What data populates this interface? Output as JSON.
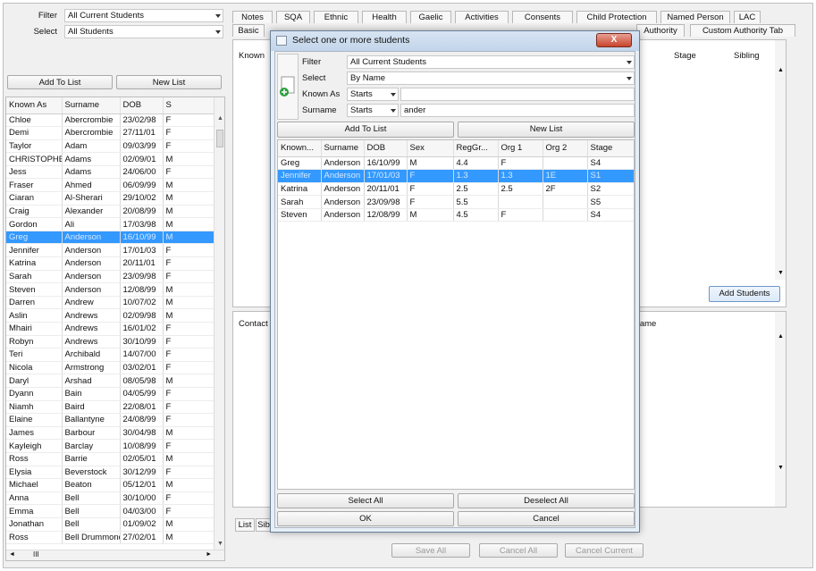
{
  "left": {
    "filter_label": "Filter",
    "filter_value": "All Current Students",
    "select_label": "Select",
    "select_value": "All Students",
    "add_to_list": "Add To List",
    "new_list": "New List",
    "columns": [
      "Known As",
      "Surname",
      "DOB",
      "S"
    ],
    "rows": [
      [
        "Chloe",
        "Abercrombie",
        "23/02/98",
        "F"
      ],
      [
        "Demi",
        "Abercrombie",
        "27/11/01",
        "F"
      ],
      [
        "Taylor",
        "Adam",
        "09/03/99",
        "F"
      ],
      [
        "CHRISTOPHER",
        "Adams",
        "02/09/01",
        "M"
      ],
      [
        "Jess",
        "Adams",
        "24/06/00",
        "F"
      ],
      [
        "Fraser",
        "Ahmed",
        "06/09/99",
        "M"
      ],
      [
        "Ciaran",
        "Al-Sherari",
        "29/10/02",
        "M"
      ],
      [
        "Craig",
        "Alexander",
        "20/08/99",
        "M"
      ],
      [
        "Gordon",
        "Ali",
        "17/03/98",
        "M"
      ],
      [
        "Greg",
        "Anderson",
        "16/10/99",
        "M"
      ],
      [
        "Jennifer",
        "Anderson",
        "17/01/03",
        "F"
      ],
      [
        "Katrina",
        "Anderson",
        "20/11/01",
        "F"
      ],
      [
        "Sarah",
        "Anderson",
        "23/09/98",
        "F"
      ],
      [
        "Steven",
        "Anderson",
        "12/08/99",
        "M"
      ],
      [
        "Darren",
        "Andrew",
        "10/07/02",
        "M"
      ],
      [
        "Aslin",
        "Andrews",
        "02/09/98",
        "M"
      ],
      [
        "Mhairi",
        "Andrews",
        "16/01/02",
        "F"
      ],
      [
        "Robyn",
        "Andrews",
        "30/10/99",
        "F"
      ],
      [
        "Teri",
        "Archibald",
        "14/07/00",
        "F"
      ],
      [
        "Nicola",
        "Armstrong",
        "03/02/01",
        "F"
      ],
      [
        "Daryl",
        "Arshad",
        "08/05/98",
        "M"
      ],
      [
        "Dyann",
        "Bain",
        "04/05/99",
        "F"
      ],
      [
        "Niamh",
        "Baird",
        "22/08/01",
        "F"
      ],
      [
        "Elaine",
        "Ballantyne",
        "24/08/99",
        "F"
      ],
      [
        "James",
        "Barbour",
        "30/04/98",
        "M"
      ],
      [
        "Kayleigh",
        "Barclay",
        "10/08/99",
        "F"
      ],
      [
        "Ross",
        "Barrie",
        "02/05/01",
        "M"
      ],
      [
        "Elysia",
        "Beverstock",
        "30/12/99",
        "F"
      ],
      [
        "Michael",
        "Beaton",
        "05/12/01",
        "M"
      ],
      [
        "Anna",
        "Bell",
        "30/10/00",
        "F"
      ],
      [
        "Emma",
        "Bell",
        "04/03/00",
        "F"
      ],
      [
        "Jonathan",
        "Bell",
        "01/09/02",
        "M"
      ],
      [
        "Ross",
        "Bell Drummond",
        "27/02/01",
        "M"
      ]
    ],
    "selected_row": 9,
    "hscroll_text": "III"
  },
  "tabs_row1": [
    "Notes",
    "SQA",
    "Ethnic",
    "Health",
    "Gaelic",
    "Activities",
    "Consents",
    "Child Protection",
    "Named Person",
    "LAC"
  ],
  "tabs_row2": [
    "Basic",
    "Authority",
    "Custom Authority Tab"
  ],
  "right": {
    "known_as_header": "Known",
    "stage_header": "Stage",
    "sibling_header": "Sibling",
    "add_students": "Add Students",
    "contact_header": "Contact",
    "name_header": "Name",
    "list_tab": "List",
    "second_tab": "Sib",
    "save_all": "Save All",
    "cancel_all": "Cancel All",
    "cancel_current": "Cancel Current"
  },
  "dialog": {
    "title": "Select one or more students",
    "close": "X",
    "filter_label": "Filter",
    "filter_value": "All Current Students",
    "select_label": "Select",
    "select_value": "By Name",
    "known_as_label": "Known As",
    "known_as_mode": "Starts",
    "known_as_value": "",
    "surname_label": "Surname",
    "surname_mode": "Starts",
    "surname_value": "ander",
    "add_to_list": "Add To List",
    "new_list": "New List",
    "columns": [
      "Known...",
      "Surname",
      "DOB",
      "Sex",
      "RegGr...",
      "Org 1",
      "Org 2",
      "Stage"
    ],
    "rows": [
      [
        "Greg",
        "Anderson",
        "16/10/99",
        "M",
        "4.4",
        "F",
        "",
        "S4"
      ],
      [
        "Jennifer",
        "Anderson",
        "17/01/03",
        "F",
        "1.3",
        "1.3",
        "1E",
        "S1"
      ],
      [
        "Katrina",
        "Anderson",
        "20/11/01",
        "F",
        "2.5",
        "2.5",
        "2F",
        "S2"
      ],
      [
        "Sarah",
        "Anderson",
        "23/09/98",
        "F",
        "5.5",
        "",
        "",
        "S5"
      ],
      [
        "Steven",
        "Anderson",
        "12/08/99",
        "M",
        "4.5",
        "F",
        "",
        "S4"
      ]
    ],
    "selected_row": 1,
    "select_all": "Select All",
    "deselect_all": "Deselect All",
    "ok": "OK",
    "cancel": "Cancel"
  }
}
